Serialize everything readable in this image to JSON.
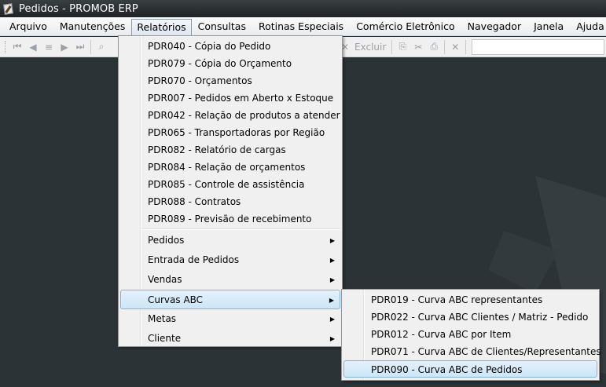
{
  "window": {
    "title": "Pedidos - PROMOB ERP"
  },
  "menubar": {
    "items": [
      {
        "label": "Arquivo"
      },
      {
        "label": "Manutenções"
      },
      {
        "label": "Relatórios"
      },
      {
        "label": "Consultas"
      },
      {
        "label": "Rotinas Especiais"
      },
      {
        "label": "Comércio Eletrônico"
      },
      {
        "label": "Navegador"
      },
      {
        "label": "Janela"
      },
      {
        "label": "Ajuda"
      }
    ]
  },
  "toolbar": {
    "delete_label": "Excluir"
  },
  "relatorios_menu": {
    "reports": [
      {
        "label": "PDR040 - Cópia do Pedido"
      },
      {
        "label": "PDR079 - Cópia do Orçamento"
      },
      {
        "label": "PDR070 - Orçamentos"
      },
      {
        "label": "PDR007 - Pedidos em Aberto x Estoque"
      },
      {
        "label": "PDR042 - Relação de produtos a atender"
      },
      {
        "label": "PDR065 - Transportadoras por Região"
      },
      {
        "label": "PDR082 - Relatório de cargas"
      },
      {
        "label": "PDR084 - Relação de orçamentos"
      },
      {
        "label": "PDR085 - Controle de assistência"
      },
      {
        "label": "PDR088 - Contratos"
      },
      {
        "label": "PDR089 - Previsão de recebimento"
      }
    ],
    "submenus": [
      {
        "label": "Pedidos"
      },
      {
        "label": "Entrada de Pedidos"
      },
      {
        "label": "Vendas"
      },
      {
        "label": "Curvas ABC"
      },
      {
        "label": "Metas"
      },
      {
        "label": "Cliente"
      }
    ]
  },
  "curvas_abc_menu": {
    "items": [
      {
        "label": "PDR019 - Curva ABC representantes"
      },
      {
        "label": "PDR022 - Curva ABC Clientes / Matriz - Pedido"
      },
      {
        "label": "PDR012 - Curva ABC por Item"
      },
      {
        "label": "PDR071 - Curva ABC de Clientes/Representantes"
      },
      {
        "label": "PDR090 - Curva ABC de Pedidos"
      }
    ]
  }
}
